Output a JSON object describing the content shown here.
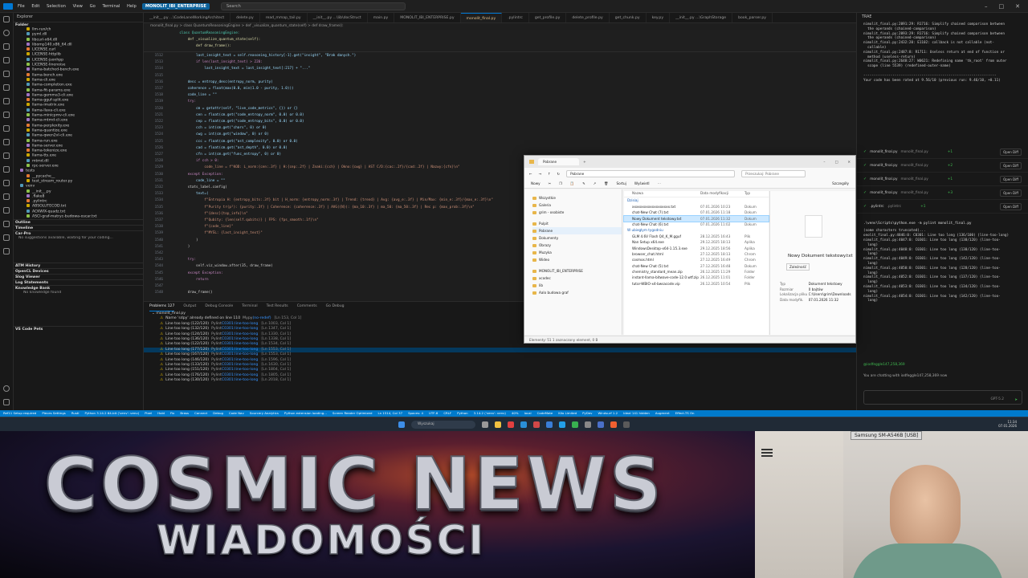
{
  "titlebar": {
    "menus": [
      "File",
      "Edit",
      "Selection",
      "View",
      "Go",
      "Terminal",
      "Help"
    ],
    "project": "MONOLIT_IBI_ENTERPRISE",
    "search": "Search"
  },
  "explorer": {
    "header": "Explorer",
    "folder_label": "Folder",
    "items": [
      "llm-run/ch",
      "pyml.dll",
      "libcurl-x64.dll",
      "libomp140.x86_64.dll",
      "LICENSE.curl",
      "LICENSE-httplib",
      "LICENSE-jsonhpp",
      "LICENSE-linenoise",
      "llama-batched-bench.exe",
      "llama-bench.exe",
      "llama-cli.exe",
      "llama-completion.exe",
      "llama-fit-params.exe",
      "llama-gemma3-cli.exe",
      "llama-gguf-split.exe",
      "llama-imatrix.exe",
      "llama-llava-cli.exe",
      "llama-minicpmv-cli.exe",
      "llama-mtmd-cli.exe",
      "llama-perplexity.exe",
      "llama-quantize.exe",
      "llama-qwen2vl-cli.exe",
      "llama-run.exe",
      "llama-server.exe",
      "llama-tokenize.exe",
      "llama-tts.exe",
      "mtmd.dll",
      "rpc-server.exe",
      "tests",
      "__pycache__",
      "test_stream_router.py",
      "venv",
      "__init__.py",
      ".flake8",
      ".pylintrc",
      "ABSOLUTECOD.txt",
      "ACKWIX-quadz.txt",
      "ASCI-graf-matryc-budowa-oscar.txt"
    ],
    "sections": [
      "Outline",
      "Timeline",
      "Car-Pro",
      "ATM History",
      "OpenCL Devices",
      "Slog Viewer",
      "Log Statements",
      "Knowledge Bank",
      "VS Code Pets"
    ],
    "carpro_note": "No suggestions available, waiting for your coding...",
    "kb_note": "No knowledge found"
  },
  "tabs": [
    {
      "label": "__init__.py ...\\CodeLaneWorkingArchitect",
      "mod": false,
      "active": false
    },
    {
      "label": "delete.py",
      "mod": false,
      "active": false
    },
    {
      "label": "read_mmap_tail.py",
      "mod": false,
      "active": false
    },
    {
      "label": "__init__.py ...\\lib\\docStruct",
      "mod": false,
      "active": false
    },
    {
      "label": "main.py",
      "mod": false,
      "active": false
    },
    {
      "label": "MONOLIT_IBI_ENTERPRISE.py",
      "mod": false,
      "active": false
    },
    {
      "label": "monolit_final.py",
      "mod": true,
      "active": true
    },
    {
      "label": ".pylintrc",
      "mod": false,
      "active": false
    },
    {
      "label": "get_profile.py",
      "mod": false,
      "active": false
    },
    {
      "label": "delete_profile.py",
      "mod": false,
      "active": false
    },
    {
      "label": "get_chunk.py",
      "mod": false,
      "active": false
    },
    {
      "label": "key.py",
      "mod": false,
      "active": false
    },
    {
      "label": "__init__.py ...\\GraphStorage",
      "mod": false,
      "active": false
    },
    {
      "label": "book_parser.py",
      "mod": false,
      "active": false
    }
  ],
  "breadcrumb": "monolit_final.py > class QuantumReasoningEngine > def _visualize_quantum_state(self) > def draw_frame():",
  "editor": {
    "lines": [
      {
        "n": "1512",
        "t": "            last_insight_text = self.reasoning_history[-1].get(\"insight\", \"Brak danych.\")"
      },
      {
        "n": "1513",
        "t": "            if len(last_insight_text) > 220:"
      },
      {
        "n": "1514",
        "t": "                last_insight_text = last_insight_text[:217] + \"...\""
      },
      {
        "n": "1515",
        "t": ""
      },
      {
        "n": "1516",
        "t": "        desc = entropy_desc(entropy_norm, purity)"
      },
      {
        "n": "1517",
        "t": "        coherence = float(max(0.0, min(1.0 - purity, 1.0)))"
      },
      {
        "n": "1518",
        "t": "        code_line = \"\""
      },
      {
        "n": "1519",
        "t": "        try:"
      },
      {
        "n": "1520",
        "t": "            cm = getattr(self, \"live_code_metrics\", {}) or {}"
      },
      {
        "n": "1521",
        "t": "            cen = float(cm.get(\"code_entropy_norm\", 0.0) or 0.0)"
      },
      {
        "n": "1522",
        "t": "            cep = float(cm.get(\"code_entropy_bits\", 0.0) or 0.0)"
      },
      {
        "n": "1523",
        "t": "            cch = int(cm.get(\"chars\", 0) or 0)"
      },
      {
        "n": "1524",
        "t": "            cwg = int(cm.get(\"window\", 0) or 0)"
      },
      {
        "n": "1525",
        "t": "            ccc = float(cm.get(\"ast_complexity\", 0.0) or 0.0)"
      },
      {
        "n": "1526",
        "t": "            cad = float(cm.get(\"ast_depth\", 0.0) or 0.0)"
      },
      {
        "n": "1527",
        "t": "            cfn = int(cm.get(\"func_entropy\", 0) or 0)"
      },
      {
        "n": "1528",
        "t": "            if cch > 0:"
      },
      {
        "n": "1529",
        "t": "                code_line = f\"KOD: L_norm:{cen:.3f} | H:{cep:.2f} | Znaki:{cch} | Okno:{cwg} | AST C/D:{cac:.2f}/{cad:.2f} | Nazwy:{cfn}\\n\""
      },
      {
        "n": "1530",
        "t": "        except Exception:"
      },
      {
        "n": "1531",
        "t": "            code_line = \"\""
      },
      {
        "n": "1532",
        "t": "        stats_label.config("
      },
      {
        "n": "1533",
        "t": "            text=("
      },
      {
        "n": "1534",
        "t": "                f\"Entropia H: {entropy_bits:.3f} bit | H_norm: {entropy_norm:.3f} | Trend: {trend} | Avg: {avg_e:.3f} | Min/Max: {min_e:.3f}/{max_e:.3f}\\n\""
      },
      {
        "n": "1535",
        "t": "                f\"Purity tr(p²): {purity:.3f} | Coherence: {coherence:.3f} | AVG({N}): {ma_10:.3f} | ma_50: {ma_50:.3f} | Rec p: {max_prob:.3f}\\n\""
      },
      {
        "n": "1536",
        "t": "                f\"{desc}{top_info}\\n\""
      },
      {
        "n": "1537",
        "t": "                f\"Qubity: {len(self.qubits)} | FPS: {fps_smooth:.1f}\\n\""
      },
      {
        "n": "1538",
        "t": "                f\"{code_line}\""
      },
      {
        "n": "1539",
        "t": "                f\"MYŚL: {last_insight_text}\""
      },
      {
        "n": "1540",
        "t": "            )"
      },
      {
        "n": "1541",
        "t": "        )"
      },
      {
        "n": "1542",
        "t": ""
      },
      {
        "n": "1543",
        "t": "        try:"
      },
      {
        "n": "1544",
        "t": "            self.viz_window.after(35, draw_frame)"
      },
      {
        "n": "1545",
        "t": "        except Exception:"
      },
      {
        "n": "1546",
        "t": "            return"
      },
      {
        "n": "1547",
        "t": ""
      },
      {
        "n": "1548",
        "t": "        draw_frame()"
      }
    ],
    "sticky": [
      "    class QuantumReasoningEngine:",
      "        def _visualize_quantum_state(self):",
      "            def draw_frame():"
    ]
  },
  "panel": {
    "tabs": [
      "Problems 127",
      "Output",
      "Debug Console",
      "Terminal",
      "Test Results",
      "Comments",
      "Go Debug"
    ],
    "file": "monolit_final.py",
    "rows": [
      {
        "msg": "Name 'sdpy' already defined on line 110",
        "src": "Mypy",
        "code": "(no-redef)",
        "pos": "[Ln 153, Col 1]"
      },
      {
        "msg": "Line too long (122/120)",
        "src": "Pylint",
        "code": "C0301:line-too-long",
        "pos": "[Ln 1003, Col 1]"
      },
      {
        "msg": "Line too long (132/120)",
        "src": "Pylint",
        "code": "C0301:line-too-long",
        "pos": "[Ln 1347, Col 1]"
      },
      {
        "msg": "Line too long (124/120)",
        "src": "Pylint",
        "code": "C0301:line-too-long",
        "pos": "[Ln 1330, Col 1]"
      },
      {
        "msg": "Line too long (136/120)",
        "src": "Pylint",
        "code": "C0301:line-too-long",
        "pos": "[Ln 1338, Col 1]"
      },
      {
        "msg": "Line too long (122/120)",
        "src": "Pylint",
        "code": "C0301:line-too-long",
        "pos": "[Ln 1534, Col 1]"
      },
      {
        "msg": "Line too long (177/120)",
        "src": "Pylint",
        "code": "C0301:line-too-long",
        "pos": "[Ln 1553, Col 1]"
      },
      {
        "msg": "Line too long (167/120)",
        "src": "Pylint",
        "code": "C0301:line-too-long",
        "pos": "[Ln 1553, Col 1]"
      },
      {
        "msg": "Line too long (146/120)",
        "src": "Pylint",
        "code": "C0301:line-too-long",
        "pos": "[Ln 1596, Col 1]"
      },
      {
        "msg": "Line too long (133/120)",
        "src": "Pylint",
        "code": "C0301:line-too-long",
        "pos": "[Ln 1630, Col 1]"
      },
      {
        "msg": "Line too long (151/120)",
        "src": "Pylint",
        "code": "C0301:line-too-long",
        "pos": "[Ln 1804, Col 1]"
      },
      {
        "msg": "Line too long (176/120)",
        "src": "Pylint",
        "code": "C0301:line-too-long",
        "pos": "[Ln 1805, Col 1]"
      },
      {
        "msg": "Line too long (130/120)",
        "src": "Pylint",
        "code": "C0301:line-too-long",
        "pos": "[Ln 2018, Col 1]"
      }
    ]
  },
  "chat": {
    "title": "TRAE",
    "log_top": "nimolit_final.py:2091:29: R1716: Simplify chained comparison between\n  the operands (chained-comparison)\nnimolit_final.py:2093:29: R1716: Simplify chained comparison between\n  the operands (chained-comparison)\nnimolit_final.py:2432:20: E1102: callback is not callable (not-\n  callable)\nnimolit_final.py:2487:8: R1711: Useless return at end of function or\n  method (useless-return)\nnimolit_final.py:2648:27: W0621: Redefining name 'tk_root' from outer\n  scope (line 5539) (redefined-outer-name)\n\n----------------------------------------------------------------\nYour code has been rated at 9.56/10 (previous run: 9.46/10, +0.11)",
    "actions": [
      {
        "label": "monolit_final.py",
        "note": "monolit_final.py",
        "add": "+1"
      },
      {
        "label": "monolit_final.py",
        "note": "monolit_final.py",
        "add": "+2"
      },
      {
        "label": "monolit_final.py",
        "note": "monolit_final.py",
        "add": "+1"
      },
      {
        "label": "monolit_final.py",
        "note": "monolit_final.py",
        "add": "+3"
      },
      {
        "label": ".pylintrc",
        "note": ".pylintrc",
        "add": "+1"
      }
    ],
    "open_diff": "Open Diff",
    "terminal_cmd": ".\\venv\\Scripts\\python.exe -m pylint monolit_final.py",
    "log_bottom": "(some characters truncated)...\nonolit_final.py:4846:0: C0301: Line too long (136/100) (line-too-long)\nnimolit_final.py:4047:0: C0301: Line too long (138/120) (line-too-\n  long)\nnimolit_final.py:4048:0: C0301: Line too long (138/120) (line-too-\n  long)\nnimolit_final.py:4049:0: C0301: Line too long (142/120) (line-too-\n  long)\nnimolit_final.py:4050:0: C0301: Line too long (128/120) (line-too-\n  long)\nnimolit_final.py:4052:0: C0301: Line too long (137/120) (line-too-\n  long)\nnimolit_final.py:4053:0: C0301: Line too long (134/120) (line-too-\n  long)\nnimolit_final.py:4054:0: C0301: Line too long (142/120) (line-too-\n  long)",
    "user": "@iodfeggle147,258,369",
    "chatting_with": "You are chatting with iodfeggle147,258,369 now",
    "model": "GPT-5.2"
  },
  "statusbar": {
    "items": [
      "Ref11 Setup required",
      "Pieces Settings",
      "Rusti",
      "Python 3.14.2 64-bit ('venv': venv)",
      "Pixel",
      "Hold",
      "Fix",
      "Brass",
      "Connect",
      "Debug",
      "Code Nav",
      "Sourcery Analytics",
      "Python extension loading...",
      "Screen Reader Optimized",
      "Ln 1514, Col 37",
      "Spaces: 4",
      "UTF-8",
      "CRLF",
      "Python",
      "3.14.2 ('venv': venv)",
      "40%",
      "local",
      "CodeMate",
      "Kilo Limited",
      "PyDev",
      "Windsurf 1.2",
      "Ideal 141 hidden",
      "Augment",
      "Effect-TS On"
    ]
  },
  "taskbar": {
    "search": "Wyszukaj",
    "time": "11:34",
    "date": "07.01.2026"
  },
  "file_explorer": {
    "tab": "Pobrane",
    "address": "Pobrane",
    "search": "Przeszukaj: Pobrane",
    "toolbar": [
      "Nowy",
      "Sortuj",
      "Wyświetl",
      "Szczegóły"
    ],
    "nav": [
      "Wszystkie",
      "Galeria",
      "grim - osobiste",
      "Pulpit",
      "Pobrane",
      "Dokumenty",
      "Obrazy",
      "Muzyka",
      "Wideo",
      "MONOLIT_IBI_ENTERPRISE",
      "xcodec",
      "lib",
      "Aalo budowa graf"
    ],
    "columns": [
      "Nazwa",
      "Data modyfikacji",
      "Typ"
    ],
    "group_today": "Dzisiaj",
    "group_week": "W ubiegłym tygodniu",
    "files_today": [
      {
        "n": "xxxxxxxxxxxxxxxxxxx.txt",
        "d": "07.01.2026 10:23",
        "t": "Dokum",
        "sel": false
      },
      {
        "n": "chat-New Chat (7).txt",
        "d": "07.01.2026 11:18",
        "t": "Dokum",
        "sel": false
      },
      {
        "n": "Nowy Dokument tekstowy.txt",
        "d": "07.01.2026 11:32",
        "t": "Dokum",
        "sel": true
      },
      {
        "n": "chat-New Chat (6).txt",
        "d": "07.01.2026 11:02",
        "t": "Dokum",
        "sel": false
      }
    ],
    "files_week": [
      {
        "n": "GLM 4.6V Flash Q4_K_M.gguf",
        "d": "28.12.2025 16:43",
        "t": "Plik",
        "sel": false
      },
      {
        "n": "Nan Setup x64.exe",
        "d": "29.12.2025 18:13",
        "t": "Aplika",
        "sel": false
      },
      {
        "n": "WindowsDesktop-x64-1.15.3.exe",
        "d": "29.12.2025 18:56",
        "t": "Aplika",
        "sel": false
      },
      {
        "n": "browser_chat.html",
        "d": "27.12.2025 18:13",
        "t": "Chrom",
        "sel": false
      },
      {
        "n": "cosmos.html",
        "d": "27.12.2025 16:49",
        "t": "Chrom",
        "sel": false
      },
      {
        "n": "chat-New Chat (5).txt",
        "d": "27.12.2025 16:48",
        "t": "Dokum",
        "sel": false
      },
      {
        "n": "chemistry_standard_mean.zip",
        "d": "26.12.2025 11:29",
        "t": "Folder",
        "sel": false
      },
      {
        "n": "instant-llama-bitwave-code-12.0.wtf.zip",
        "d": "26.12.2025 11:01",
        "t": "Folder",
        "sel": false
      },
      {
        "n": "tutor-WBIO-x4-bwsacode.vip",
        "d": "26.12.2025 10:54",
        "t": "Plik",
        "sel": false
      }
    ],
    "preview_title": "Nowy Dokument tekstowy.txt",
    "preview_sub": "Zależność",
    "preview_props": [
      [
        "Typ",
        "Dokument tekstowy"
      ],
      [
        "Rozmiar",
        "0 bajtów"
      ],
      [
        "Lokalizacja pliku",
        "C:\\Users\\grim\\Downloads"
      ],
      [
        "Data modyfik.",
        "07.01.2026 11:32"
      ]
    ],
    "statusbar": "Elementy: 51    1 zaznaczony element, 0 B"
  },
  "banner": {
    "title": "COSMIC NEWS",
    "subtitle": "WIADOMOŚCI"
  },
  "webcam": {
    "label": "Samsung SM-A546B [USB]"
  }
}
